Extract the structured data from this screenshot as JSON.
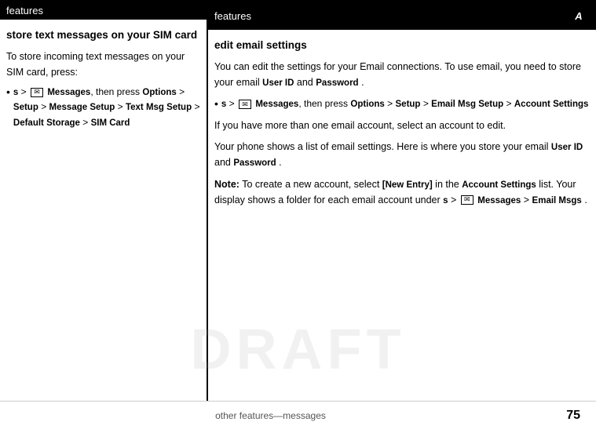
{
  "left": {
    "header": "features",
    "title": "store text messages on your SIM card",
    "body1": "To store incoming text messages on your SIM card, press:",
    "bullet": "s > Messages, then press Options > Setup > Message Setup > Text Msg Setup > Default Storage > SIM Card",
    "bullet_parts": {
      "sym": "s",
      "text1": " > ",
      "icon": "msg",
      "text2": " Messages, then press ",
      "opt1": "Options",
      "text3": " > ",
      "opt2": "Setup",
      "text4": " > ",
      "opt3": "Message Setup",
      "text5": " > ",
      "opt4": "Text Msg Setup",
      "text6": " > ",
      "opt5": "Default Storage",
      "text7": " > ",
      "opt6": "SIM Card"
    }
  },
  "right": {
    "header": "features",
    "title": "edit email settings",
    "para1": "You can edit the settings for your Email connections. To use email, you need to store your email",
    "para1_uid": "User ID",
    "para1_and": "and",
    "para1_pass": "Password",
    "bullet_parts": {
      "sym": "s",
      "text1": " > ",
      "icon": "msg",
      "text2": " Messages, then press ",
      "opt1": "Options",
      "text3": " > ",
      "opt2": "Setup",
      "text4": " > ",
      "opt3": "Email Msg Setup",
      "text5": " > ",
      "opt4": "Account Settings"
    },
    "para2": "If you have more than one email account, select an account to edit.",
    "para3_pre": "Your phone shows a list of email settings. Here is where you store your email",
    "para3_uid": "User ID",
    "para3_and": "and",
    "para3_pass": "Password",
    "note_label": "Note:",
    "note_text": "To create a new account, select",
    "note_new": "[New Entry]",
    "note_in": "in the",
    "note_acct": "Account Settings",
    "note_list": "list. Your display shows a folder for each email account under",
    "note_sym": "s",
    "note_gt": " > ",
    "note_icon": "msg",
    "note_msgs": "Messages",
    "note_gt2": " > ",
    "note_email": "Email Msgs"
  },
  "footer": {
    "left": "",
    "center": "other features—messages",
    "page": "75"
  },
  "watermark": "DRAFT"
}
